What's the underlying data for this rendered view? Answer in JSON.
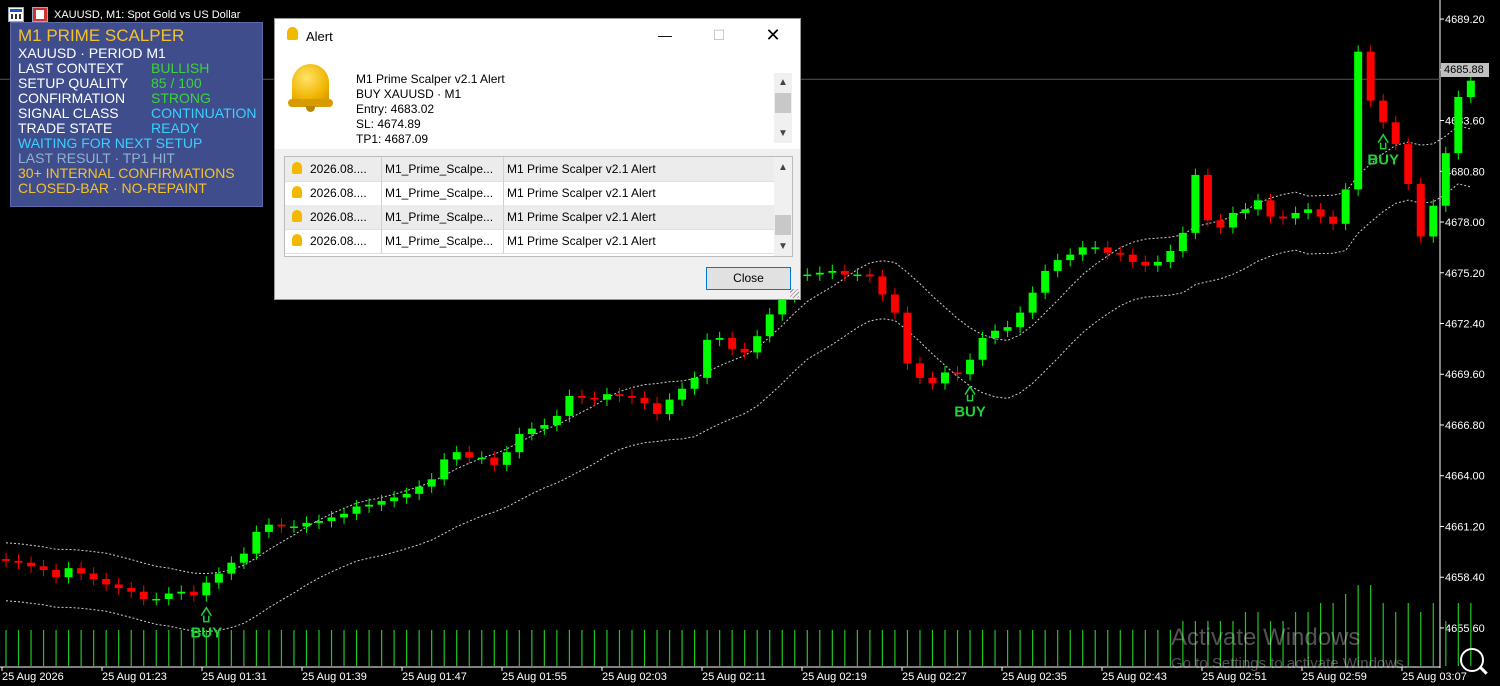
{
  "window": {
    "symbol_title": "XAUUSD, M1:  Spot Gold vs US Dollar",
    "chart_icon": "chart-window-icon",
    "terminal_icon": "terminal-logo-icon"
  },
  "panel": {
    "title": "M1 PRIME SCALPER",
    "symbol_line": "XAUUSD · PERIOD M1",
    "rows": [
      {
        "label": "LAST CONTEXT",
        "value": "BULLISH",
        "color": "#3cd23c"
      },
      {
        "label": "SETUP QUALITY",
        "value": "85 / 100",
        "color": "#3cd23c"
      },
      {
        "label": "CONFIRMATION",
        "value": "STRONG",
        "color": "#3cd23c"
      },
      {
        "label": "SIGNAL CLASS",
        "value": "CONTINUATION",
        "color": "#3ad0ff"
      },
      {
        "label": "TRADE STATE",
        "value": "READY",
        "color": "#3ad0ff"
      }
    ],
    "status_lines": [
      {
        "text": "WAITING FOR NEXT SETUP",
        "color": "#3ad0ff"
      },
      {
        "text": "LAST RESULT · TP1 HIT",
        "color": "#8fb3d0"
      },
      {
        "text": "30+ INTERNAL CONFIRMATIONS",
        "color": "#f6c22b"
      },
      {
        "text": "CLOSED-BAR · NO-REPAINT",
        "color": "#f6c22b"
      }
    ],
    "background": "#3f4d8c",
    "title_color": "#f6c22b"
  },
  "alert": {
    "title": "Alert",
    "minimize": "—",
    "maximize": "☐",
    "close_x": "✕",
    "message_lines": [
      "M1 Prime Scalper v2.1 Alert",
      "BUY XAUUSD · M1",
      "Entry: 4683.02",
      "SL: 4674.89",
      "TP1: 4687.09"
    ],
    "scroll_up": "▲",
    "scroll_down": "▼",
    "list_rows": [
      {
        "time": "2026.08....",
        "source": "M1_Prime_Scalpe...",
        "message": "M1 Prime Scalper v2.1 Alert"
      },
      {
        "time": "2026.08....",
        "source": "M1_Prime_Scalpe...",
        "message": "M1 Prime Scalper v2.1 Alert"
      },
      {
        "time": "2026.08....",
        "source": "M1_Prime_Scalpe...",
        "message": "M1 Prime Scalper v2.1 Alert"
      },
      {
        "time": "2026.08....",
        "source": "M1_Prime_Scalpe...",
        "message": "M1 Prime Scalper v2.1 Alert"
      }
    ],
    "close_button": "Close"
  },
  "watermark": {
    "line1": "Activate Windows",
    "line2": "Go to Settings to activate Windows."
  },
  "chart_data": {
    "type": "candlestick",
    "title": "XAUUSD, M1:  Spot Gold vs US Dollar",
    "current_price": "4685.88",
    "ylim": [
      4653.5,
      4689.7
    ],
    "price_ticks": [
      "4689.20",
      "4686.40",
      "4683.60",
      "4680.80",
      "4678.00",
      "4675.20",
      "4672.40",
      "4669.60",
      "4666.80",
      "4664.00",
      "4661.20",
      "4658.40",
      "4655.60"
    ],
    "time_ticks": [
      "25 Aug 2026",
      "25 Aug 01:23",
      "25 Aug 01:31",
      "25 Aug 01:39",
      "25 Aug 01:47",
      "25 Aug 01:55",
      "25 Aug 02:03",
      "25 Aug 02:11",
      "25 Aug 02:19",
      "25 Aug 02:27",
      "25 Aug 02:35",
      "25 Aug 02:43",
      "25 Aug 02:51",
      "25 Aug 02:59",
      "25 Aug 03:07"
    ],
    "bull_color": "#00ff00",
    "bear_color": "#ff0000",
    "signal_label": "BUY",
    "signal_color": "#1fd13a",
    "signals": [
      16,
      77,
      110
    ],
    "series": [
      {
        "name": "close",
        "values": [
          4659.3,
          4659.2,
          4659.0,
          4658.8,
          4658.4,
          4658.9,
          4658.6,
          4658.3,
          4658.0,
          4657.8,
          4657.6,
          4657.2,
          4657.2,
          4657.5,
          4657.6,
          4657.4,
          4658.1,
          4658.6,
          4659.2,
          4659.7,
          4660.9,
          4661.3,
          4661.2,
          4661.2,
          4661.4,
          4661.5,
          4661.7,
          4661.9,
          4662.3,
          4662.4,
          4662.6,
          4662.8,
          4663.0,
          4663.4,
          4663.8,
          4664.9,
          4665.3,
          4665.0,
          4665.0,
          4664.6,
          4665.3,
          4666.3,
          4666.6,
          4666.8,
          4667.3,
          4668.4,
          4668.3,
          4668.2,
          4668.5,
          4668.4,
          4668.3,
          4668.0,
          4667.4,
          4668.2,
          4668.8,
          4669.4,
          4671.5,
          4671.6,
          4671.0,
          4670.8,
          4671.7,
          4672.9,
          4673.9,
          4675.1,
          4675.1,
          4675.2,
          4675.3,
          4675.1,
          4675.1,
          4675.0,
          4674.0,
          4673.0,
          4670.2,
          4669.4,
          4669.1,
          4669.7,
          4669.6,
          4670.4,
          4671.6,
          4672.0,
          4672.2,
          4673.0,
          4674.1,
          4675.3,
          4675.9,
          4676.2,
          4676.6,
          4676.6,
          4676.3,
          4676.2,
          4675.8,
          4675.6,
          4675.8,
          4676.4,
          4677.4,
          4680.6,
          4678.1,
          4677.7,
          4678.5,
          4678.7,
          4679.2,
          4678.3,
          4678.2,
          4678.5,
          4678.7,
          4678.3,
          4677.9,
          4679.8,
          4687.4,
          4684.7,
          4683.5,
          4682.3,
          4680.1,
          4677.2,
          4678.9,
          4681.8,
          4684.9,
          4685.8
        ]
      },
      {
        "name": "open",
        "values": [
          4659.4,
          4659.3,
          4659.2,
          4659.0,
          4658.8,
          4658.4,
          4658.9,
          4658.6,
          4658.3,
          4658.0,
          4657.8,
          4657.6,
          4657.2,
          4657.2,
          4657.5,
          4657.6,
          4657.4,
          4658.1,
          4658.6,
          4659.2,
          4659.7,
          4660.9,
          4661.3,
          4661.2,
          4661.2,
          4661.4,
          4661.5,
          4661.7,
          4661.9,
          4662.3,
          4662.4,
          4662.6,
          4662.8,
          4663.0,
          4663.4,
          4663.8,
          4664.9,
          4665.3,
          4665.0,
          4665.0,
          4664.6,
          4665.3,
          4666.3,
          4666.6,
          4666.8,
          4667.3,
          4668.4,
          4668.3,
          4668.2,
          4668.5,
          4668.4,
          4668.3,
          4668.0,
          4667.4,
          4668.2,
          4668.8,
          4669.4,
          4671.5,
          4671.6,
          4671.0,
          4670.8,
          4671.7,
          4672.9,
          4673.9,
          4675.1,
          4675.1,
          4675.2,
          4675.3,
          4675.1,
          4675.1,
          4675.0,
          4674.0,
          4673.0,
          4670.2,
          4669.4,
          4669.1,
          4669.7,
          4669.6,
          4670.4,
          4671.6,
          4672.0,
          4672.2,
          4673.0,
          4674.1,
          4675.3,
          4675.9,
          4676.2,
          4676.6,
          4676.6,
          4676.3,
          4676.2,
          4675.8,
          4675.6,
          4675.8,
          4676.4,
          4677.4,
          4680.6,
          4678.1,
          4677.7,
          4678.5,
          4678.7,
          4679.2,
          4678.3,
          4678.2,
          4678.5,
          4678.7,
          4678.3,
          4677.9,
          4679.8,
          4687.4,
          4684.7,
          4683.5,
          4682.3,
          4680.1,
          4677.2,
          4678.9,
          4681.8,
          4684.9
        ]
      },
      {
        "name": "volume",
        "values": [
          4,
          4,
          4,
          4,
          4,
          4,
          4,
          4,
          4,
          4,
          4,
          4,
          4,
          4,
          4,
          4,
          4,
          4,
          4,
          4,
          4,
          4,
          4,
          4,
          4,
          4,
          4,
          4,
          4,
          4,
          4,
          4,
          4,
          4,
          4,
          4,
          4,
          4,
          4,
          4,
          4,
          4,
          4,
          4,
          4,
          4,
          4,
          4,
          4,
          4,
          4,
          4,
          4,
          4,
          4,
          4,
          4,
          4,
          4,
          4,
          4,
          4,
          4,
          4,
          4,
          4,
          4,
          4,
          4,
          4,
          4,
          4,
          4,
          4,
          4,
          4,
          4,
          4,
          4,
          4,
          4,
          4,
          4,
          4,
          4,
          4,
          4,
          4,
          4,
          4,
          4,
          4,
          4,
          4,
          5,
          5,
          5,
          5,
          5,
          6,
          6,
          5,
          5,
          6,
          6,
          7,
          7,
          8,
          9,
          9,
          7,
          6,
          7,
          6,
          7,
          5,
          7,
          7
        ]
      }
    ]
  }
}
